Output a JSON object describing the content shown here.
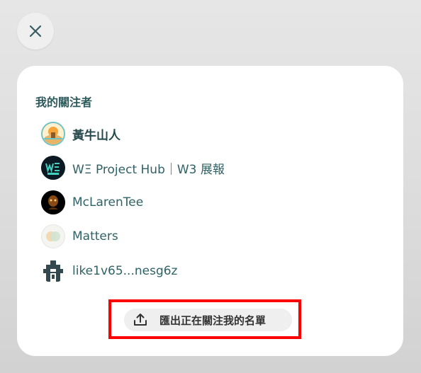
{
  "dialog": {
    "title": "我的關注者",
    "followers": [
      {
        "name": "黃牛山人",
        "avatar": "illustrated-landscape-avatar-icon"
      },
      {
        "name": "WΞ Project Hub｜W3 展報",
        "avatar": "we-project-hub-logo-icon"
      },
      {
        "name": "McLarenTee",
        "avatar": "dark-portrait-avatar-icon"
      },
      {
        "name": "Matters",
        "avatar": "matters-logo-icon"
      },
      {
        "name": "like1v65...nesg6z",
        "avatar": "pixel-identicon-avatar-icon"
      }
    ],
    "export_button": {
      "label": "匯出正在關注我的名單",
      "icon": "upload-icon"
    }
  },
  "colors": {
    "accent_text": "#2d5a5a",
    "highlight": "#ff0000"
  }
}
